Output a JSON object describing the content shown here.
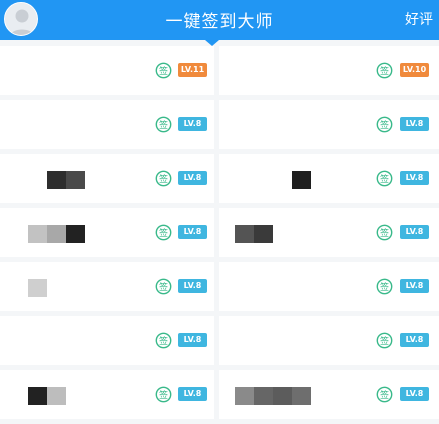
{
  "header": {
    "title": "一键签到大师",
    "action": "好评",
    "avatar_icon": "user-avatar-icon"
  },
  "colors": {
    "primary": "#2196f3",
    "sign_icon": "#39b98a",
    "level_blue": "#3fb6e0",
    "level_orange": "#f08a3c"
  },
  "rows": [
    {
      "left": {
        "level": "LV.11",
        "level_color": "orange",
        "blocks": []
      },
      "right": {
        "level": "LV.10",
        "level_color": "orange",
        "blocks": []
      }
    },
    {
      "left": {
        "level": "LV.8",
        "level_color": "blue",
        "blocks": []
      },
      "right": {
        "level": "LV.8",
        "level_color": "blue",
        "blocks": []
      }
    },
    {
      "left": {
        "level": "LV.8",
        "level_color": "blue",
        "blocks": [
          "#ffffff",
          "#2e2e2e",
          "#4a4a4a"
        ]
      },
      "right": {
        "level": "LV.8",
        "level_color": "blue",
        "blocks": [
          "#ffffff",
          "#ffffff",
          "#ffffff",
          "#1f1f1f"
        ]
      }
    },
    {
      "left": {
        "level": "LV.8",
        "level_color": "blue",
        "blocks": [
          "#c2c2c2",
          "#a8a8a8",
          "#222222"
        ]
      },
      "right": {
        "level": "LV.8",
        "level_color": "blue",
        "blocks": [
          "#545454",
          "#3a3a3a"
        ]
      }
    },
    {
      "left": {
        "level": "LV.8",
        "level_color": "blue",
        "blocks": [
          "#cfcfcf"
        ]
      },
      "right": {
        "level": "LV.8",
        "level_color": "blue",
        "blocks": []
      }
    },
    {
      "left": {
        "level": "LV.8",
        "level_color": "blue",
        "blocks": []
      },
      "right": {
        "level": "LV.8",
        "level_color": "blue",
        "blocks": []
      }
    },
    {
      "left": {
        "level": "LV.8",
        "level_color": "blue",
        "blocks": [
          "#222222",
          "#bdbdbd"
        ]
      },
      "right": {
        "level": "LV.8",
        "level_color": "blue",
        "blocks": [
          "#8a8a8a",
          "#666666",
          "#5c5c5c",
          "#6e6e6e"
        ]
      }
    }
  ]
}
